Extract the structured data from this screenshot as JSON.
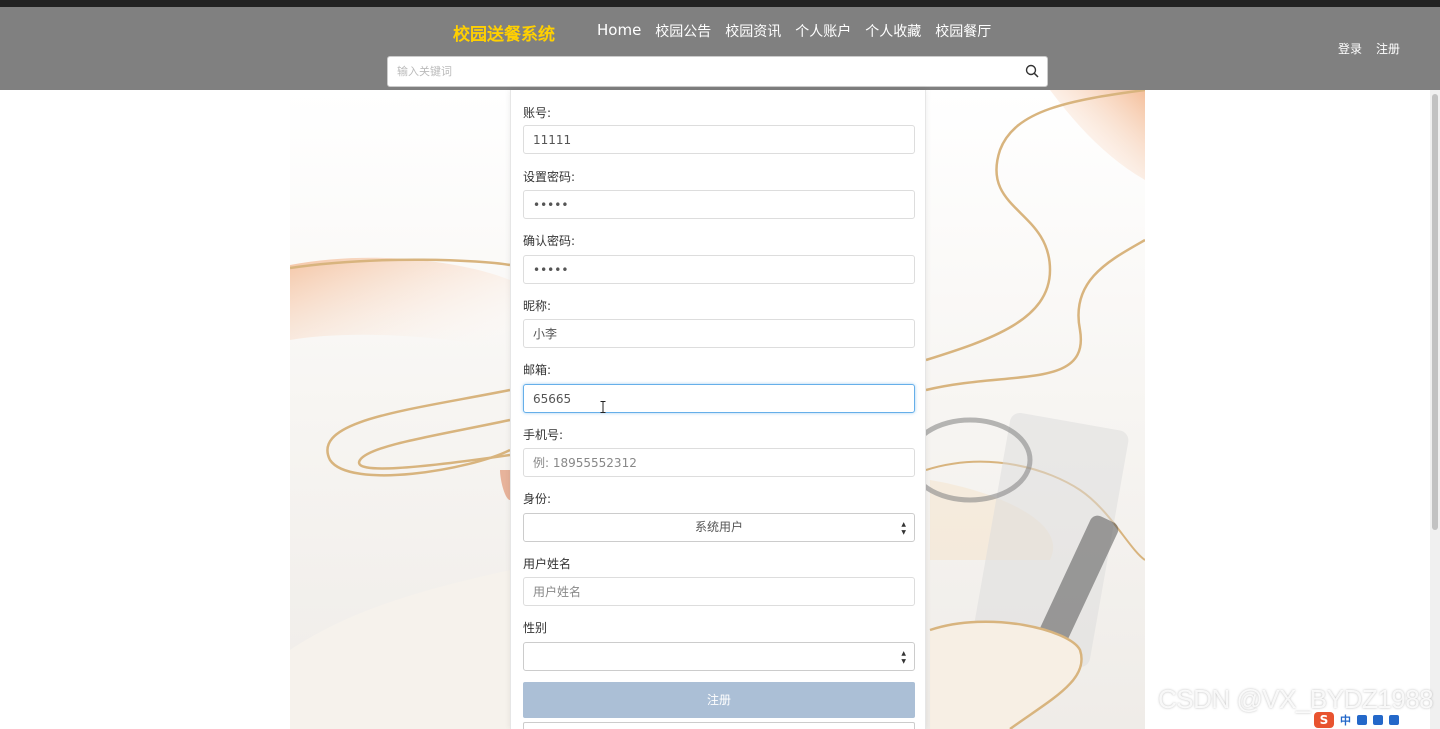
{
  "nav": {
    "brand": "校园送餐系统",
    "links": [
      "Home",
      "校园公告",
      "校园资讯",
      "个人账户",
      "个人收藏",
      "校园餐厅"
    ],
    "login": "登录",
    "register": "注册"
  },
  "search": {
    "placeholder": "输入关键词",
    "icon": "search-icon"
  },
  "form": {
    "account_label": "账号:",
    "account_value": "11111",
    "password_label": "设置密码:",
    "password_value": "•••••",
    "confirm_label": "确认密码:",
    "confirm_value": "•••••",
    "nickname_label": "昵称:",
    "nickname_value": "小李",
    "email_label": "邮箱:",
    "email_value": "65665",
    "phone_label": "手机号:",
    "phone_placeholder": "例: 18955552312",
    "role_label": "身份:",
    "role_value": "系统用户",
    "realname_label": "用户姓名",
    "realname_placeholder": "用户姓名",
    "gender_label": "性别",
    "gender_value": "",
    "submit_label": "注册"
  },
  "overlay": {
    "watermark": "CSDN @VX_BYDZ1988",
    "ime_s": "S",
    "ime_lang": "中"
  },
  "colors": {
    "navbar_bg": "#808080",
    "brand": "#ffd000",
    "submit_bg": "#abbfd6",
    "focus_border": "#66afe9"
  }
}
